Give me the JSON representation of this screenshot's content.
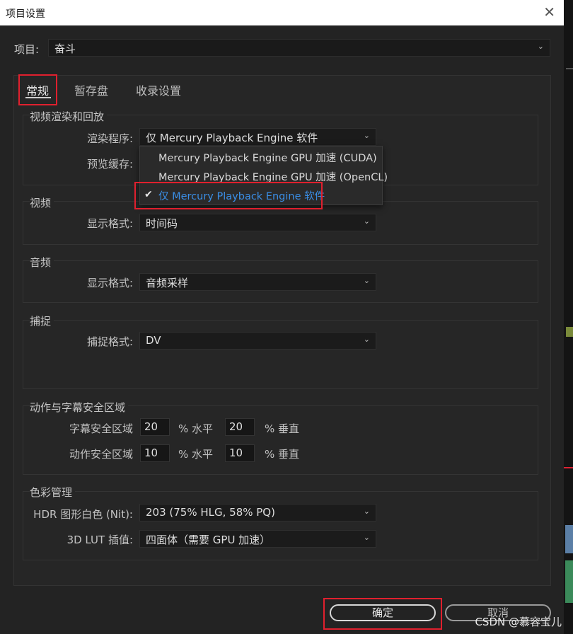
{
  "window": {
    "title": "项目设置",
    "close_glyph": "✕"
  },
  "project": {
    "label": "项目:",
    "value": "奋斗"
  },
  "tabs": [
    {
      "label": "常规",
      "active": true
    },
    {
      "label": "暂存盘",
      "active": false
    },
    {
      "label": "收录设置",
      "active": false
    }
  ],
  "video_render": {
    "title": "视频渲染和回放",
    "renderer_label": "渲染程序:",
    "renderer_value": "仅 Mercury Playback Engine 软件",
    "preview_cache_label": "预览缓存:",
    "dropdown_options": [
      {
        "label": "Mercury Playback Engine GPU 加速 (CUDA)",
        "selected": false
      },
      {
        "label": "Mercury Playback Engine GPU 加速 (OpenCL)",
        "selected": false
      },
      {
        "label": "仅 Mercury Playback Engine 软件",
        "selected": true
      }
    ]
  },
  "video": {
    "title": "视频",
    "display_format_label": "显示格式:",
    "display_format_value": "时间码"
  },
  "audio": {
    "title": "音频",
    "display_format_label": "显示格式:",
    "display_format_value": "音频采样"
  },
  "capture": {
    "title": "捕捉",
    "capture_format_label": "捕捉格式:",
    "capture_format_value": "DV"
  },
  "safe_zones": {
    "title": "动作与字幕安全区域",
    "title_safe_label": "字幕安全区域",
    "title_safe_h": "20",
    "title_safe_v": "20",
    "action_safe_label": "动作安全区域",
    "action_safe_h": "10",
    "action_safe_v": "10",
    "h_unit": "% 水平",
    "v_unit": "% 垂直"
  },
  "color": {
    "title": "色彩管理",
    "hdr_label": "HDR 图形白色 (Nit):",
    "hdr_value": "203 (75% HLG, 58% PQ)",
    "lut_label": "3D LUT 插值:",
    "lut_value": "四面体（需要 GPU 加速）"
  },
  "buttons": {
    "ok_label": "确定",
    "cancel_label": "取消"
  },
  "watermark": "CSDN @慕容宝儿",
  "icons": {
    "chevron": "chevron-down-icon",
    "check": "checkmark-icon",
    "close": "close-icon"
  },
  "colors": {
    "highlight": "#e0202e",
    "selected_option": "#3a8ee6"
  }
}
